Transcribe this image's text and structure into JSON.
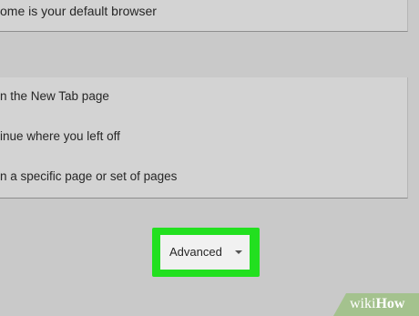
{
  "default_browser_card": {
    "status_text": "ome is your default browser"
  },
  "on_startup_card": {
    "options": [
      "n the New Tab page",
      "inue where you left off",
      "n a specific page or set of pages"
    ]
  },
  "advanced_button": {
    "label": "Advanced",
    "icon": "chevron-down-icon",
    "highlight_color": "#22e01f"
  },
  "watermark": {
    "prefix": "wiki",
    "suffix": "How",
    "color": "#a4c28e"
  }
}
